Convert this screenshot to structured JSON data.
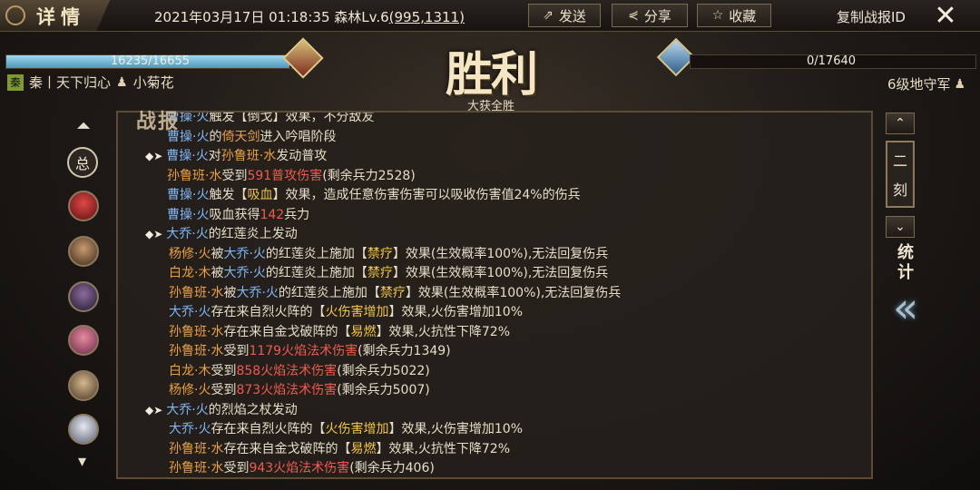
{
  "header": {
    "title": "详情",
    "datetime": "2021年03月17日 01:18:35",
    "location": "森林Lv.6",
    "coords": "(995,1311)",
    "send_label": "发送",
    "share_label": "分享",
    "favorite_label": "收藏",
    "copy_id_label": "复制战报ID"
  },
  "battle": {
    "left_hp": "16235/16655",
    "left_hp_ratio": 0.975,
    "right_hp": "0/17640",
    "right_hp_ratio": 0,
    "result": "胜利",
    "result_sub": "大获全胜",
    "left_faction": "秦",
    "left_alliance": "秦丨天下归心",
    "left_player": "小菊花",
    "right_side": "6级地守军"
  },
  "panel": {
    "stamp": "战报",
    "summary_label": "总",
    "phase": [
      "二",
      "刻"
    ],
    "stats": [
      "统",
      "计"
    ]
  },
  "colors": {
    "blue": "#7fb7f3",
    "orange": "#e9a040",
    "red": "#ee5b4e",
    "yellow": "#f1c546"
  },
  "log": [
    {
      "l": 1,
      "mk": false,
      "segs": [
        {
          "t": "曹操·火",
          "c": "blue"
        },
        {
          "t": "触发【倒戈】效果，不分敌友",
          "c": ""
        }
      ]
    },
    {
      "l": 1,
      "mk": false,
      "segs": [
        {
          "t": "曹操·火",
          "c": "blue"
        },
        {
          "t": "的",
          "c": ""
        },
        {
          "t": "倚天剑",
          "c": "orange"
        },
        {
          "t": "进入吟唱阶段",
          "c": ""
        }
      ]
    },
    {
      "l": 0,
      "mk": true,
      "segs": [
        {
          "t": "曹操·火",
          "c": "blue"
        },
        {
          "t": "对",
          "c": ""
        },
        {
          "t": "孙鲁班·水",
          "c": "orange"
        },
        {
          "t": "发动普攻",
          "c": ""
        }
      ]
    },
    {
      "l": 1,
      "mk": false,
      "segs": [
        {
          "t": "孙鲁班·水",
          "c": "orange"
        },
        {
          "t": "受到",
          "c": ""
        },
        {
          "t": "591普攻伤害",
          "c": "red"
        },
        {
          "t": "(剩余兵力2528)",
          "c": ""
        }
      ]
    },
    {
      "l": 1,
      "mk": false,
      "segs": [
        {
          "t": "曹操·火",
          "c": "blue"
        },
        {
          "t": "触发【",
          "c": ""
        },
        {
          "t": "吸血",
          "c": "yellow"
        },
        {
          "t": "】效果，造成任意伤害伤害可以吸收伤害值24%的伤兵",
          "c": ""
        }
      ]
    },
    {
      "l": 1,
      "mk": false,
      "segs": [
        {
          "t": "曹操·火",
          "c": "blue"
        },
        {
          "t": "吸血获得",
          "c": ""
        },
        {
          "t": "142",
          "c": "red"
        },
        {
          "t": "兵力",
          "c": ""
        }
      ]
    },
    {
      "l": 0,
      "mk": true,
      "segs": [
        {
          "t": "大乔·火",
          "c": "blue"
        },
        {
          "t": "的红莲炎上发动",
          "c": ""
        }
      ]
    },
    {
      "l": 2,
      "mk": false,
      "segs": [
        {
          "t": "杨修·火",
          "c": "orange"
        },
        {
          "t": "被",
          "c": ""
        },
        {
          "t": "大乔·火",
          "c": "blue"
        },
        {
          "t": "的红莲炎上施加【",
          "c": ""
        },
        {
          "t": "禁疗",
          "c": "yellow"
        },
        {
          "t": "】效果(生效概率100%),无法回复伤兵",
          "c": ""
        }
      ]
    },
    {
      "l": 2,
      "mk": false,
      "segs": [
        {
          "t": "白龙·木",
          "c": "orange"
        },
        {
          "t": "被",
          "c": ""
        },
        {
          "t": "大乔·火",
          "c": "blue"
        },
        {
          "t": "的红莲炎上施加【",
          "c": ""
        },
        {
          "t": "禁疗",
          "c": "yellow"
        },
        {
          "t": "】效果(生效概率100%),无法回复伤兵",
          "c": ""
        }
      ]
    },
    {
      "l": 2,
      "mk": false,
      "segs": [
        {
          "t": "孙鲁班·水",
          "c": "orange"
        },
        {
          "t": "被",
          "c": ""
        },
        {
          "t": "大乔·火",
          "c": "blue"
        },
        {
          "t": "的红莲炎上施加【",
          "c": ""
        },
        {
          "t": "禁疗",
          "c": "yellow"
        },
        {
          "t": "】效果(生效概率100%),无法回复伤兵",
          "c": ""
        }
      ]
    },
    {
      "l": 2,
      "mk": false,
      "segs": [
        {
          "t": "大乔·火",
          "c": "blue"
        },
        {
          "t": "存在来自烈火阵的【",
          "c": ""
        },
        {
          "t": "火伤害增加",
          "c": "yellow"
        },
        {
          "t": "】效果,火伤害增加10%",
          "c": ""
        }
      ]
    },
    {
      "l": 2,
      "mk": false,
      "segs": [
        {
          "t": "孙鲁班·水",
          "c": "orange"
        },
        {
          "t": "存在来自金戈破阵的【",
          "c": ""
        },
        {
          "t": "易燃",
          "c": "yellow"
        },
        {
          "t": "】效果,火抗性下降72%",
          "c": ""
        }
      ]
    },
    {
      "l": 2,
      "mk": false,
      "segs": [
        {
          "t": "孙鲁班·水",
          "c": "orange"
        },
        {
          "t": "受到",
          "c": ""
        },
        {
          "t": "1179火焰法术伤害",
          "c": "red"
        },
        {
          "t": "(剩余兵力1349)",
          "c": ""
        }
      ]
    },
    {
      "l": 2,
      "mk": false,
      "segs": [
        {
          "t": "白龙·木",
          "c": "orange"
        },
        {
          "t": "受到",
          "c": ""
        },
        {
          "t": "858火焰法术伤害",
          "c": "red"
        },
        {
          "t": "(剩余兵力5022)",
          "c": ""
        }
      ]
    },
    {
      "l": 2,
      "mk": false,
      "segs": [
        {
          "t": "杨修·火",
          "c": "orange"
        },
        {
          "t": "受到",
          "c": ""
        },
        {
          "t": "873火焰法术伤害",
          "c": "red"
        },
        {
          "t": "(剩余兵力5007)",
          "c": ""
        }
      ]
    },
    {
      "l": 0,
      "mk": true,
      "segs": [
        {
          "t": "大乔·火",
          "c": "blue"
        },
        {
          "t": "的烈焰之杖发动",
          "c": ""
        }
      ]
    },
    {
      "l": 2,
      "mk": false,
      "segs": [
        {
          "t": "大乔·火",
          "c": "blue"
        },
        {
          "t": "存在来自烈火阵的【",
          "c": ""
        },
        {
          "t": "火伤害增加",
          "c": "yellow"
        },
        {
          "t": "】效果,火伤害增加10%",
          "c": ""
        }
      ]
    },
    {
      "l": 2,
      "mk": false,
      "segs": [
        {
          "t": "孙鲁班·水",
          "c": "orange"
        },
        {
          "t": "存在来自金戈破阵的【",
          "c": ""
        },
        {
          "t": "易燃",
          "c": "yellow"
        },
        {
          "t": "】效果,火抗性下降72%",
          "c": ""
        }
      ]
    },
    {
      "l": 2,
      "mk": false,
      "segs": [
        {
          "t": "孙鲁班·水",
          "c": "orange"
        },
        {
          "t": "受到",
          "c": ""
        },
        {
          "t": "943火焰法术伤害",
          "c": "red"
        },
        {
          "t": "(剩余兵力406)",
          "c": ""
        }
      ]
    }
  ]
}
